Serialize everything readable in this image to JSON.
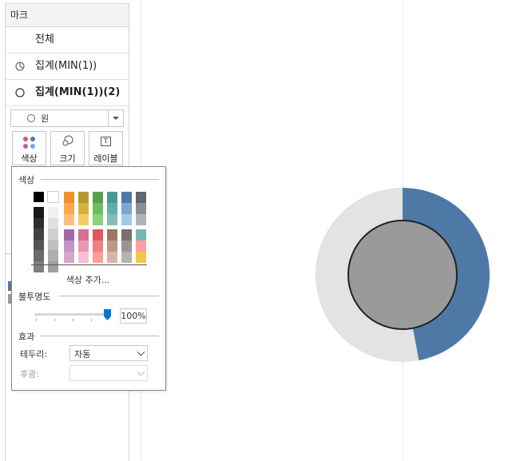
{
  "marks": {
    "title": "마크",
    "rows": [
      {
        "label": "전체",
        "icon": "none",
        "bold": false
      },
      {
        "label": "집계(MIN(1))",
        "icon": "pie-icon",
        "bold": false
      },
      {
        "label": "집계(MIN(1))(2)",
        "icon": "circle-icon",
        "bold": true
      }
    ],
    "mark_type": {
      "value": "원",
      "icon": "circle-icon"
    },
    "buttons": [
      {
        "label": "색상",
        "icon": "color-dots-icon"
      },
      {
        "label": "크기",
        "icon": "size-icon"
      },
      {
        "label": "레이블",
        "icon": "label-icon",
        "glyph": "T"
      }
    ]
  },
  "color_popup": {
    "section_color": "색상",
    "basic_colors": [
      "#000000",
      "#ffffff"
    ],
    "gray_column_1": [
      "#1a1a1a",
      "#2e2e2e",
      "#414141",
      "#545454",
      "#6a6a6a",
      "#7f7f7f"
    ],
    "gray_column_2": [
      "#f0f0f0",
      "#e0e0e0",
      "#cfcfcf",
      "#bfbfbf",
      "#afafaf",
      "#9f9f9f"
    ],
    "palette_top": [
      [
        "#f28e2b",
        "#ffa64f",
        "#ffbe7d"
      ],
      [
        "#b39a2d",
        "#d4b23c",
        "#f1ce63"
      ],
      [
        "#59a14f",
        "#6cbf5f",
        "#8cd17d"
      ],
      [
        "#499894",
        "#5cb0aa",
        "#86bcb6"
      ],
      [
        "#4e79a7",
        "#79a7d1",
        "#a0cbe8"
      ],
      [
        "#5f6770",
        "#8a8f95",
        "#b0b3b5"
      ]
    ],
    "palette_bottom": [
      [
        "#a06aa8",
        "#c295c7",
        "#d4a6c8"
      ],
      [
        "#d37295",
        "#e997b2",
        "#fabfd2"
      ],
      [
        "#e15759",
        "#f07f7f",
        "#ff9d9a"
      ],
      [
        "#9d7660",
        "#b89a86",
        "#d7b5a6"
      ],
      [
        "#79706e",
        "#9c9492",
        "#bab0ac"
      ],
      [
        "#76b7b2",
        "#ff9da7",
        "#edc948"
      ]
    ],
    "more_colors_link": "색상 추가...",
    "section_opacity": "불투명도",
    "opacity_value": "100%",
    "opacity_fraction": 1.0,
    "section_effects": "효과",
    "border_label": "테두리:",
    "border_value": "자동",
    "halo_label": "후광:",
    "halo_value": ""
  },
  "chart_data": {
    "type": "pie",
    "slices": [
      {
        "value": 47,
        "color": "#4e79a7"
      },
      {
        "value": 53,
        "color": "#e3e3e3"
      }
    ],
    "center_circle_color": "#9a9a9a"
  },
  "colors": {
    "accent": "#0078d4",
    "legend_swatches": [
      "#4e79a7",
      "#9a9a9a"
    ]
  }
}
